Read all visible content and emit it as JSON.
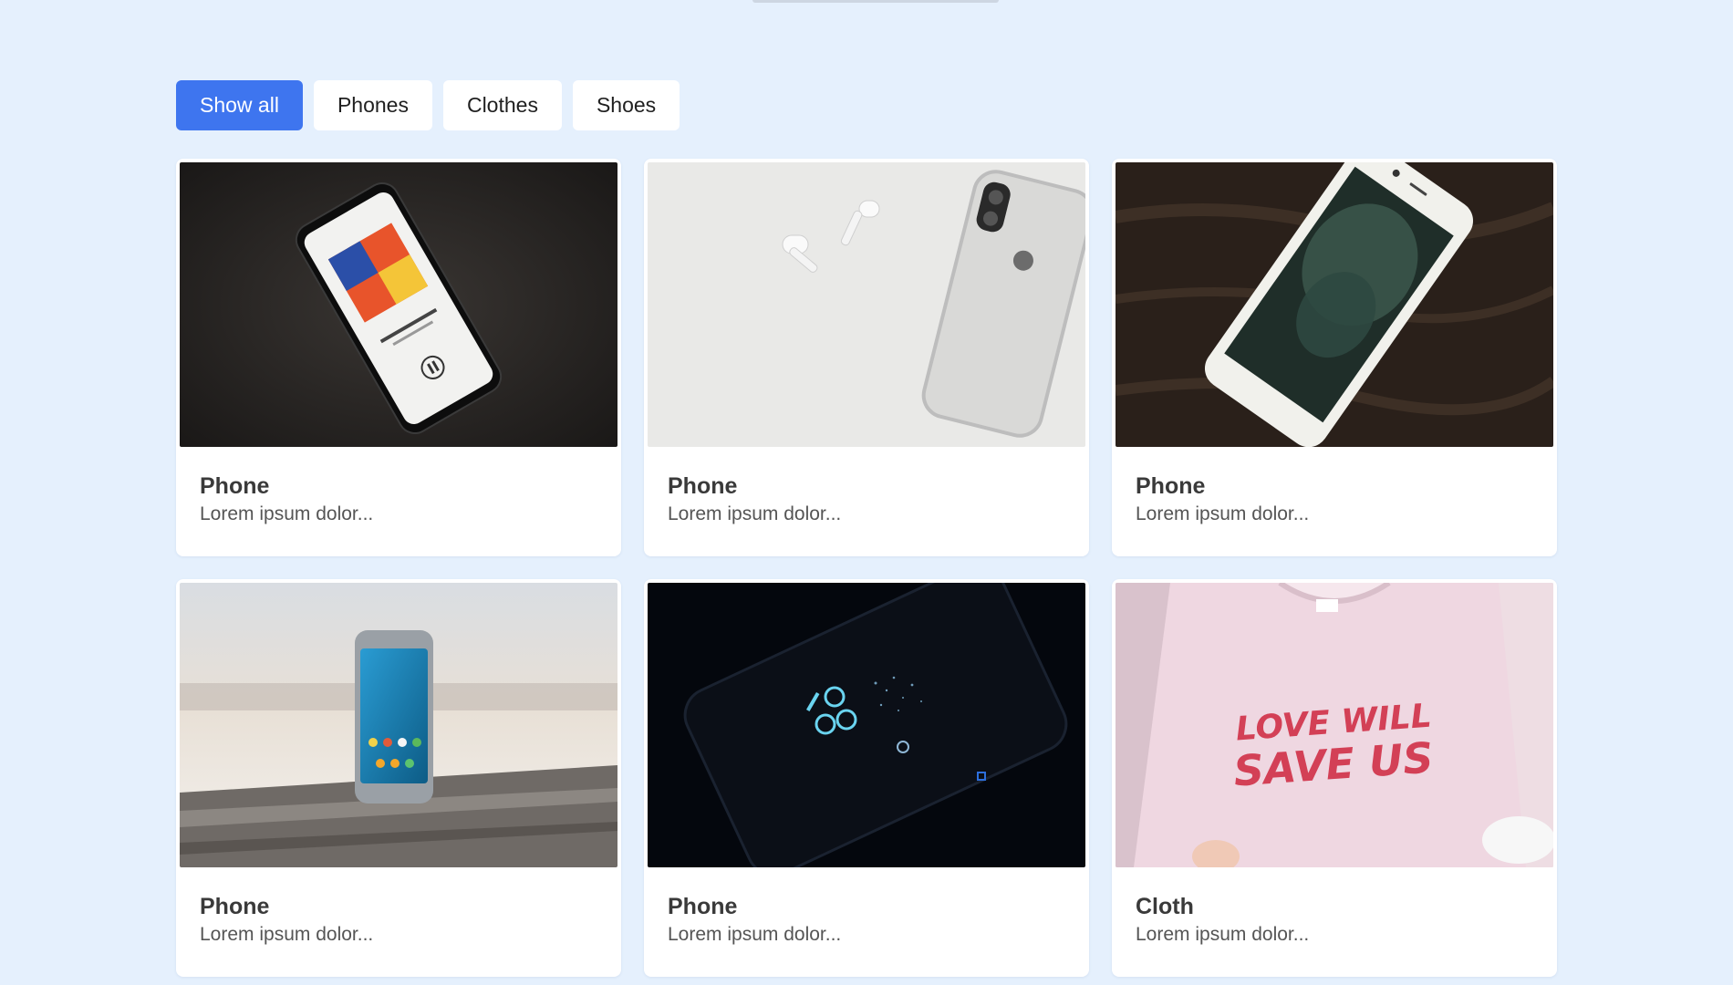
{
  "filters": [
    {
      "label": "Show all",
      "active": true
    },
    {
      "label": "Phones",
      "active": false
    },
    {
      "label": "Clothes",
      "active": false
    },
    {
      "label": "Shoes",
      "active": false
    }
  ],
  "cards": [
    {
      "title": "Phone",
      "description": "Lorem ipsum dolor...",
      "image": "black phone playing music on dark surface"
    },
    {
      "title": "Phone",
      "description": "Lorem ipsum dolor...",
      "image": "silver phone with wireless earbuds on white surface"
    },
    {
      "title": "Phone",
      "description": "Lorem ipsum dolor...",
      "image": "white phone on dark wooden table"
    },
    {
      "title": "Phone",
      "description": "Lorem ipsum dolor...",
      "image": "phone standing on weathered wooden bench outdoors"
    },
    {
      "title": "Phone",
      "description": "Lorem ipsum dolor...",
      "image": "phone showing lock screen clock in dark"
    },
    {
      "title": "Cloth",
      "description": "Lorem ipsum dolor...",
      "image": "pink t-shirt printed LOVE WILL SAVE US"
    }
  ],
  "shirt_print": [
    "LOVE WILL",
    "SAVE US"
  ],
  "colors": {
    "background": "#e5f0fd",
    "accent": "#3e75ef",
    "card": "#ffffff"
  }
}
